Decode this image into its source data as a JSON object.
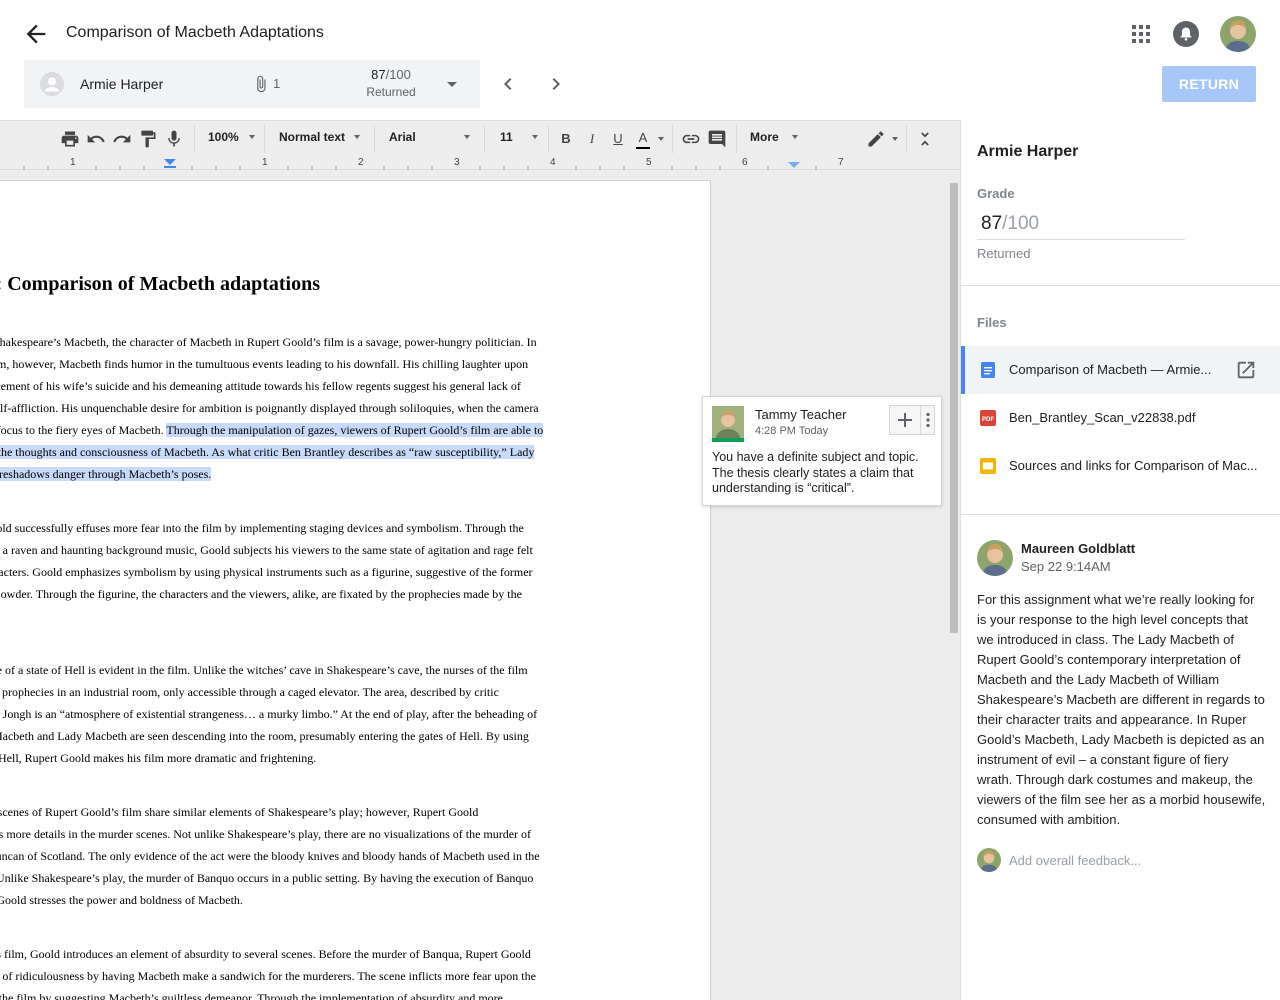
{
  "header": {
    "title": "Comparison of Macbeth Adaptations"
  },
  "student_bar": {
    "name": "Armie Harper",
    "attachment_count": "1",
    "grade_value": "87",
    "grade_total": "/100",
    "status": "Returned"
  },
  "return_button": "RETURN",
  "toolbar": {
    "zoom": "100%",
    "style": "Normal text",
    "font": "Arial",
    "size": "11",
    "bold": "B",
    "italic": "I",
    "underline": "U",
    "text_color": "A",
    "more": "More"
  },
  "ruler": {
    "numbers": [
      "1",
      "1",
      "2",
      "3",
      "4",
      "5",
      "6",
      "7"
    ]
  },
  "document": {
    "title": "ssay: Comparison of Macbeth adaptations",
    "paragraphs": [
      {
        "lines": [
          [
            {
              "t": " unlike Shakespeare’s Macbeth, the character of Macbeth in Rupert Goold’s film is a savage, power-hungry politician. In",
              "hl": false
            }
          ],
          [
            {
              "t": "old’s film, however, Macbeth finds humor in the tumultuous events leading to his downfall. His chilling laughter upon",
              "hl": false
            }
          ],
          [
            {
              "t": "announcement of his wife’s suicide and his demeaning attitude towards his fellow regents suggest his general lack of",
              "hl": false
            }
          ],
          [
            {
              "t": "lt and self-affliction. His unquenchable desire for ambition is poignantly displayed through soliloquies, when the camera",
              "hl": false
            }
          ],
          [
            {
              "t": "kes the focus to the fiery eyes of Macbeth. ",
              "hl": false
            },
            {
              "t": "Through the manipulation of gazes, viewers of Rupert Goold’s film are able to",
              "hl": true
            }
          ],
          [
            {
              "t": "erience the thoughts and consciousness of Macbeth. As what critic Ben Brantley describes as “raw susceptibility,” Lady",
              "hl": true
            }
          ],
          [
            {
              "t": "cbeth foreshadows danger through Macbeth’s poses.",
              "hl": true
            }
          ]
        ]
      },
      {
        "lines": [
          [
            {
              "t": "pert Goold successfully effuses more fear into the film by implementing staging devices and symbolism. Through the",
              "hl": false
            }
          ],
          [
            {
              "t": "aking of a raven and haunting background music, Goold subjects his viewers to the same state of agitation and rage felt",
              "hl": false
            }
          ],
          [
            {
              "t": "the characters. Goold emphasizes symbolism by using physical instruments such as a figurine, suggestive of the former",
              "hl": false
            }
          ],
          [
            {
              "t": "ane of Cowder. Through the figurine, the characters and the viewers, alike, are fixated by the prophecies made by the",
              "hl": false
            }
          ],
          [
            {
              "t": "ches.",
              "hl": false
            }
          ]
        ]
      },
      {
        "lines": [
          [
            {
              "t": " presence of a state of Hell is evident in the film. Unlike the witches’ cave in Shakespeare’s cave, the nurses of the film",
              "hl": false
            }
          ],
          [
            {
              "t": "eal their prophecies in an industrial room, only accessible through a caged elevator. The area, described by critic",
              "hl": false
            }
          ],
          [
            {
              "t": "holas de Jongh is an “atmosphere of existential strangeness… a murky limbo.” At the end of play, after the beheading of",
              "hl": false
            }
          ],
          [
            {
              "t": "cbeth, Macbeth and Lady Macbeth are seen descending into the room, presumably entering the gates of Hell. By using",
              "hl": false
            }
          ],
          [
            {
              "t": "state of Hell, Rupert Goold makes his film more dramatic and frightening.",
              "hl": false
            }
          ]
        ]
      },
      {
        "lines": [
          [
            {
              "t": " murder scenes of Rupert Goold’s film share similar elements of Shakespeare’s play; however, Rupert Goold",
              "hl": false
            }
          ],
          [
            {
              "t": "plements more details in the murder scenes. Not unlike Shakespeare’s play, there are no visualizations of the murder of",
              "hl": false
            }
          ],
          [
            {
              "t": "King Duncan of Scotland. The only evidence of the act were the bloody knives and bloody hands of Macbeth used in the",
              "hl": false
            }
          ],
          [
            {
              "t": "cution. Unlike Shakespeare’s play, the murder of Banquo occurs in a public setting. By having the execution of Banquo",
              "hl": false
            }
          ],
          [
            {
              "t": "a train, Goold stresses the power and boldness of Macbeth.",
              "hl": false
            }
          ]
        ]
      },
      {
        "lines": [
          [
            {
              "t": "ough his film, Goold introduces an element of absurdity to several scenes. Before the murder of Banqua, Rupert Goold",
              "hl": false
            }
          ],
          [
            {
              "t": "s a twist of ridiculousness by having Macbeth make a sandwich for the murderers. The scene inflicts more fear upon the",
              "hl": false
            }
          ],
          [
            {
              "t": "wers of the film by suggesting Macbeth’s guiltless demeanor. Through the implementation of absurdity and more",
              "hl": false
            }
          ]
        ]
      }
    ]
  },
  "comment": {
    "author": "Tammy Teacher",
    "time": "4:28 PM Today",
    "text": "You have a definite subject and topic. The thesis clearly states a claim that understanding is “critical”."
  },
  "right_panel": {
    "student_name": "Armie Harper",
    "grade_label": "Grade",
    "grade_value": "87",
    "grade_total": "/100",
    "grade_status": "Returned",
    "files_label": "Files",
    "files": [
      {
        "name": "Comparison of Macbeth — Armie...",
        "icon": "google-docs-icon"
      },
      {
        "name": "Ben_Brantley_Scan_v22838.pdf",
        "icon": "pdf-icon"
      },
      {
        "name": "Sources and links for Comparison of Mac...",
        "icon": "google-slides-icon"
      }
    ],
    "feedback": {
      "author": "Maureen Goldblatt",
      "time": "Sep 22 9:14AM",
      "text": "For this assignment what we’re really looking for is your response to the high level concepts that we introduced in class. The Lady Macbeth of Rupert Goold’s contemporary interpretation of Macbeth and the Lady Macbeth of William Shakespeare’s Macbeth are different in regards to their character traits and appearance. In Ruper Goold’s Macbeth, Lady Macbeth is depicted as an instrument of evil – a constant figure of fiery wrath. Through dark costumes and makeup, the viewers of the film see her as a morbid housewife, consumed with ambition."
    },
    "add_feedback_placeholder": "Add overall feedback..."
  },
  "colors": {
    "return_button": "#a7c7fa",
    "highlight": "#c8dafa",
    "selected_accent": "#4285f4",
    "docs_blue": "#4285f4",
    "pdf_red": "#db4437",
    "slides_yellow": "#f4b400",
    "comment_green": "#0f9d58"
  }
}
